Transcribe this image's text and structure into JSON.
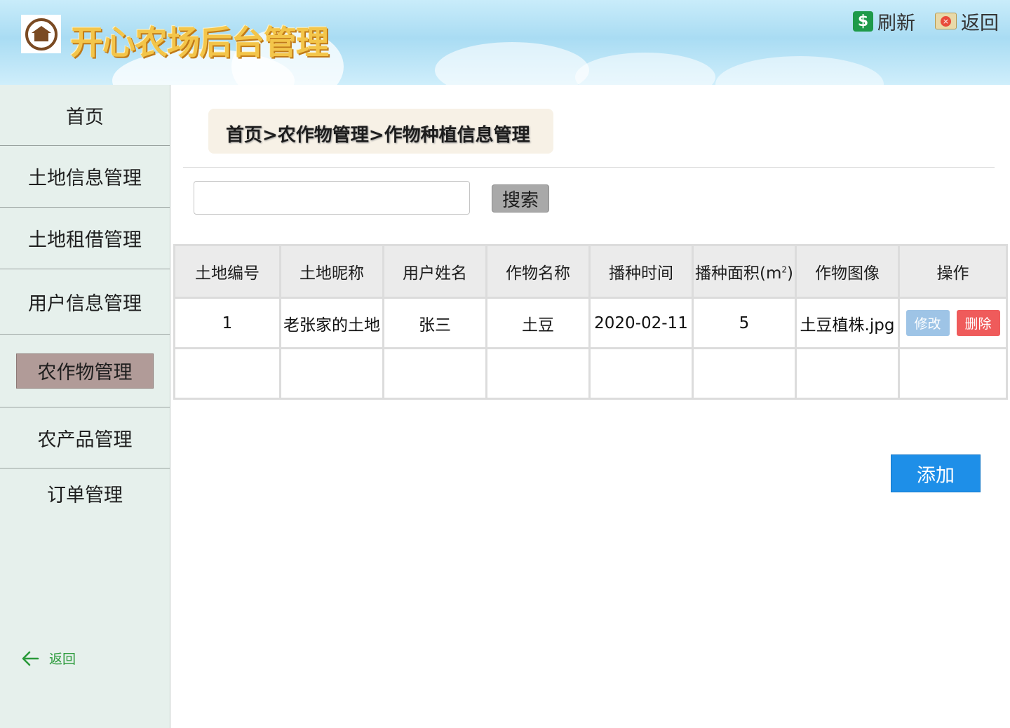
{
  "header": {
    "site_title": "开心农场后台管理",
    "refresh_label": "刷新",
    "back_label": "返回"
  },
  "sidebar": {
    "items": [
      {
        "label": "首页"
      },
      {
        "label": "土地信息管理"
      },
      {
        "label": "土地租借管理"
      },
      {
        "label": "用户信息管理"
      },
      {
        "label": "农作物管理",
        "active": true
      },
      {
        "label": "农产品管理"
      },
      {
        "label": "订单管理"
      }
    ],
    "back_label": "返回"
  },
  "breadcrumb": "首页>农作物管理>作物种植信息管理",
  "search": {
    "value": "",
    "button_label": "搜索"
  },
  "table": {
    "headers": [
      "土地编号",
      "土地昵称",
      "用户姓名",
      "作物名称",
      "播种时间",
      "播种面积(m",
      "作物图像",
      "操作"
    ],
    "area_unit_sup": "2",
    "area_unit_close": ")",
    "rows": [
      {
        "land_id": "1",
        "land_nickname": "老张家的土地",
        "user_name": "张三",
        "crop_name": "土豆",
        "sow_date": "2020-02-11",
        "sow_area": "5",
        "crop_image": "土豆植株.jpg",
        "edit_label": "修改",
        "delete_label": "删除"
      }
    ]
  },
  "add_label": "添加",
  "colors": {
    "active_nav": "#b19b98",
    "edit_button": "#9ec4e6",
    "delete_button": "#ef5b5b",
    "add_button": "#1e8fe8",
    "sidebar_bg": "#e6f0ec"
  }
}
